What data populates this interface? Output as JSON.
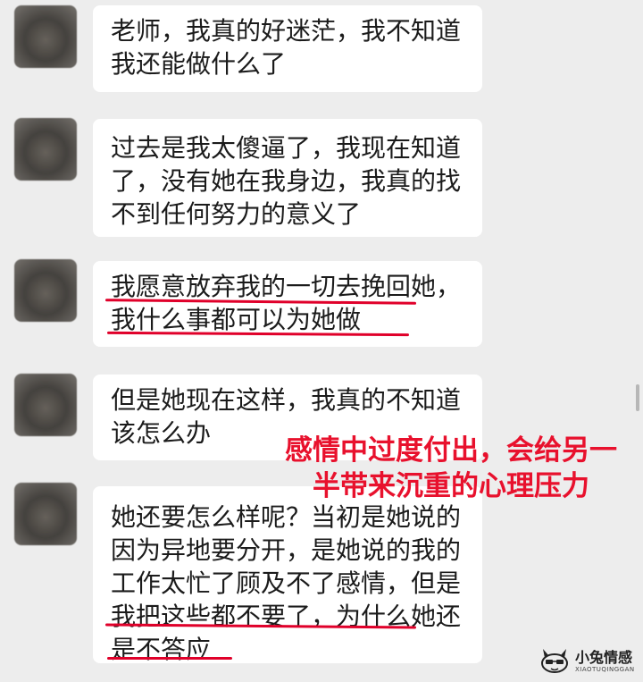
{
  "messages": [
    {
      "lines": [
        "老师，我真的好迷茫，我不知道",
        "我还能做什么了"
      ]
    },
    {
      "lines": [
        "过去是我太傻逼了，我现在知道",
        "了，没有她在我身边，我真的找",
        "不到任何努力的意义了"
      ]
    },
    {
      "lines": [
        "我愿意放弃我的一切去挽回她，",
        "我什么事都可以为她做"
      ]
    },
    {
      "lines": [
        "但是她现在这样，我真的不知道",
        "该怎么办"
      ]
    },
    {
      "lines": [
        "她还要怎么样呢？当初是她说的",
        "因为异地要分开，是她说的我的",
        "工作太忙了顾及不了感情，但是",
        "我把这些都不要了，为什么她还",
        "是不答应"
      ]
    }
  ],
  "overlay": {
    "lines": [
      "感情中过度付出，会给另一",
      "半带来沉重的心理压力"
    ]
  },
  "watermark": {
    "title": "小兔情感",
    "subtitle": "XIAOTUQINGGAN"
  },
  "colors": {
    "underline": "#e0002a",
    "overlay": "#e8112d",
    "background": "#ededed"
  }
}
